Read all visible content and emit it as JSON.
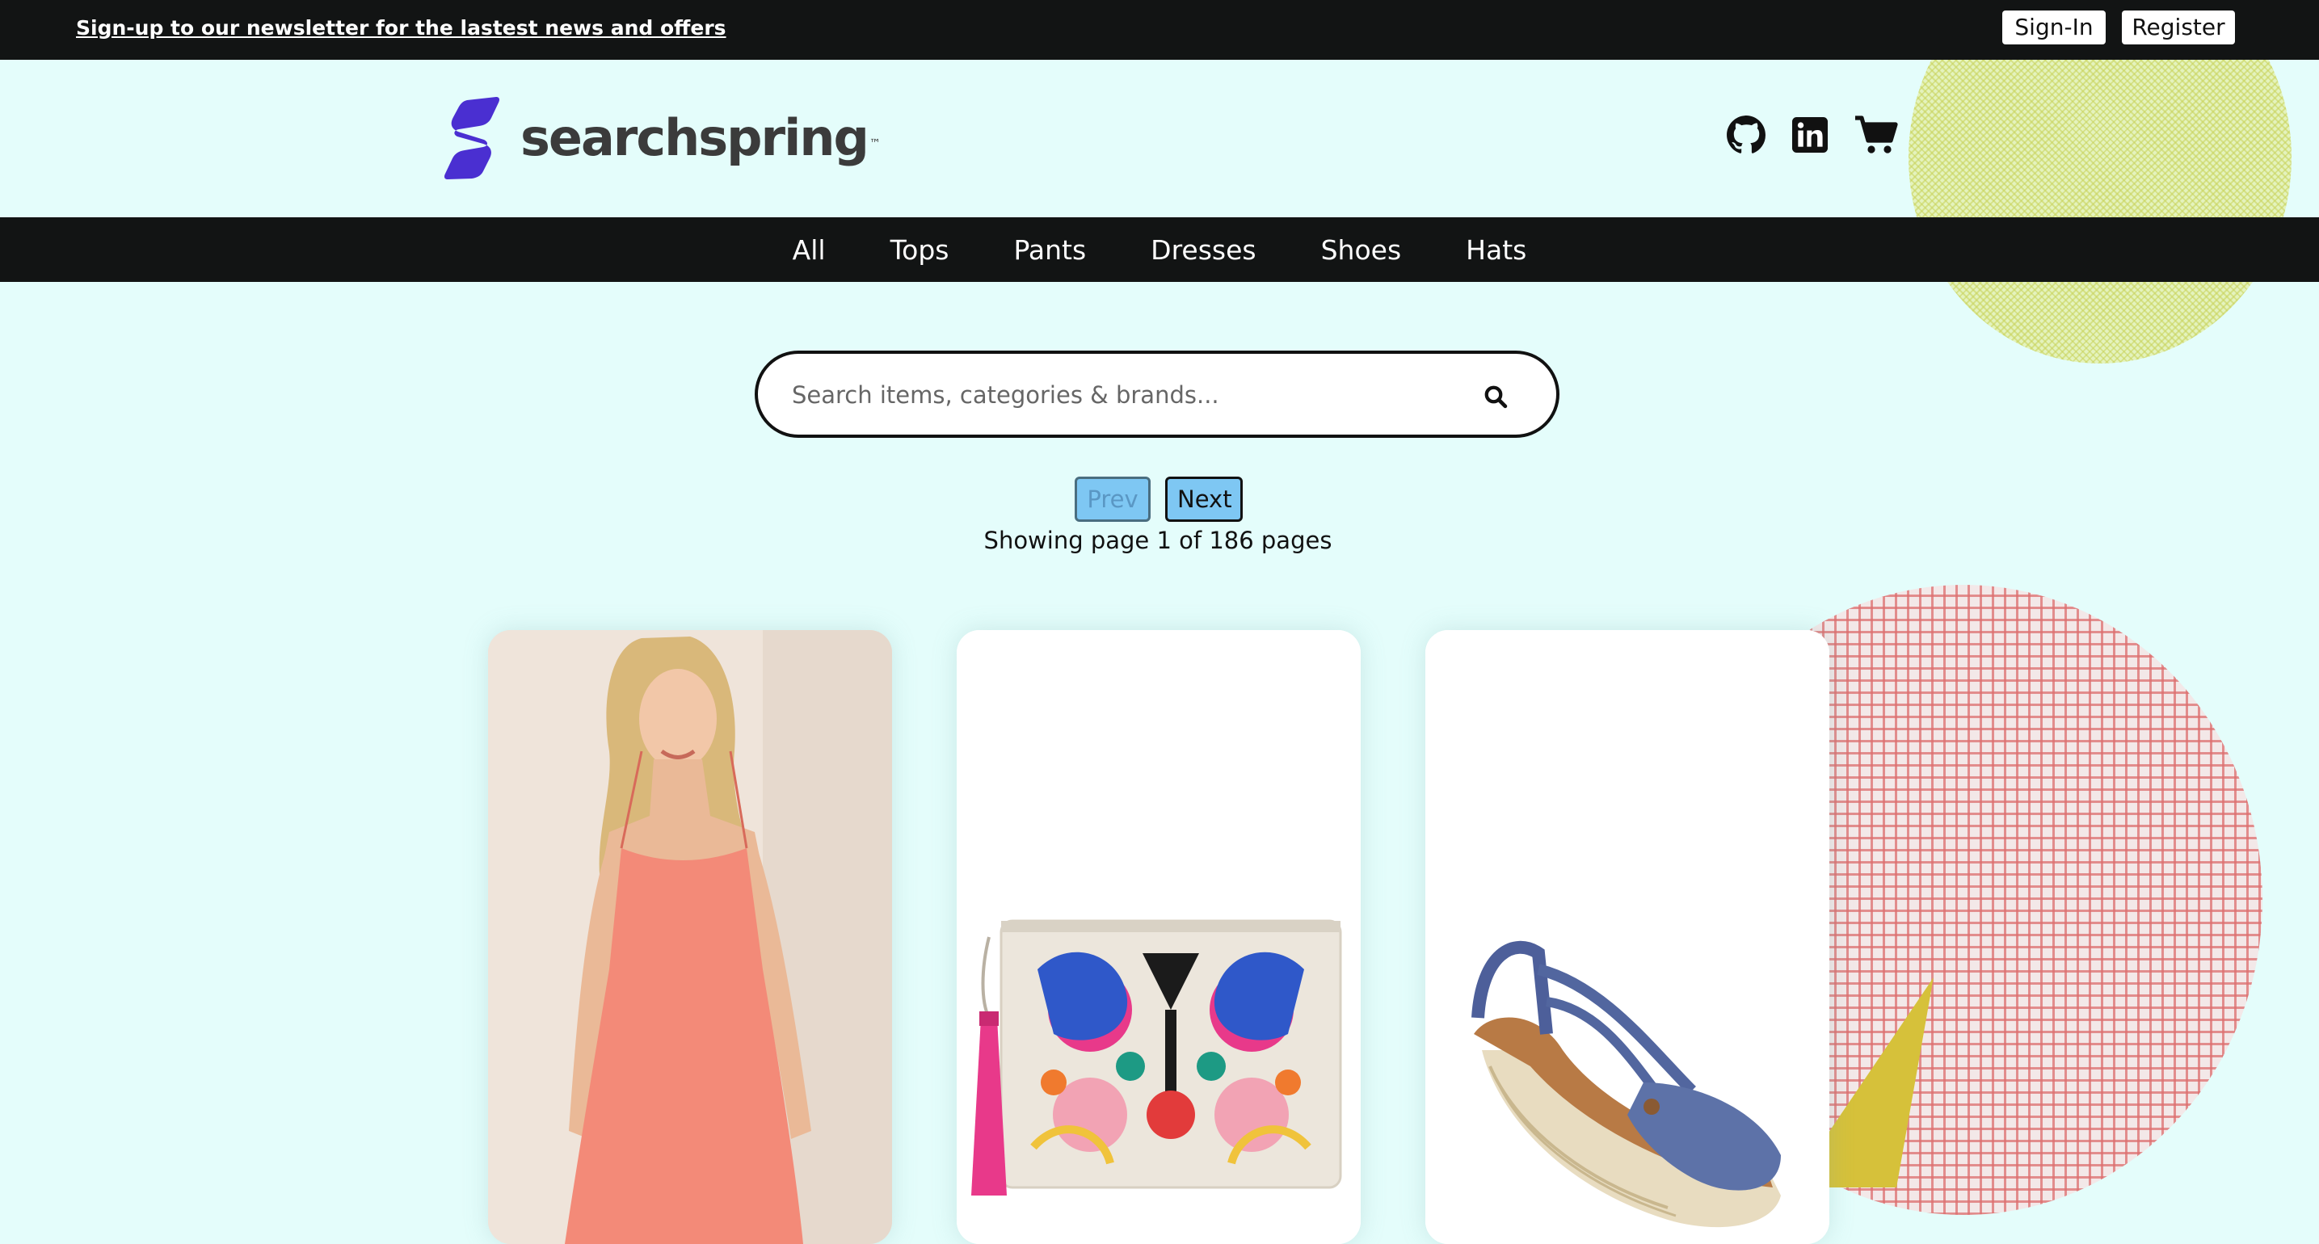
{
  "topbar": {
    "promo_text": "Sign-up to our newsletter for the lastest news and offers",
    "signin_label": "Sign-In",
    "register_label": "Register"
  },
  "header": {
    "brand": "searchspring",
    "trademark": "™",
    "icons": [
      "github-icon",
      "linkedin-icon",
      "cart-icon"
    ]
  },
  "nav": {
    "items": [
      {
        "label": "All"
      },
      {
        "label": "Tops"
      },
      {
        "label": "Pants"
      },
      {
        "label": "Dresses"
      },
      {
        "label": "Shoes"
      },
      {
        "label": "Hats"
      }
    ]
  },
  "search": {
    "placeholder": "Search items, categories & brands...",
    "value": ""
  },
  "pagination": {
    "prev_label": "Prev",
    "next_label": "Next",
    "status": "Showing page 1 of 186 pages"
  },
  "products": [
    {
      "image": "coral-slip-dress"
    },
    {
      "image": "embroidered-clutch-with-tassel"
    },
    {
      "image": "denim-espadrille-wedge"
    }
  ],
  "colors": {
    "background": "#e4fdfb",
    "bars": "#121414",
    "brand": "#4a2fd1",
    "pager_button": "#7ec7f3"
  }
}
